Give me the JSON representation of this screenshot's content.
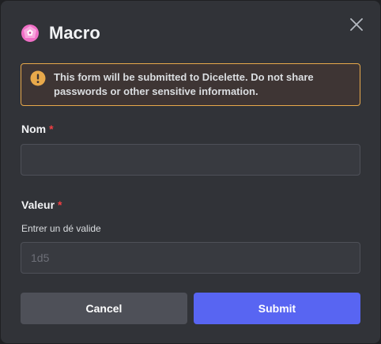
{
  "modal": {
    "title": "Macro",
    "app_icon": "pink-dice-icon",
    "close_icon": "close-icon"
  },
  "warning": {
    "icon": "exclamation-circle-icon",
    "line1": "This form will be submitted to Dicelette. Do not share",
    "line2": "passwords or other sensitive information.",
    "color": "#e8a94b"
  },
  "fields": {
    "nom": {
      "label": "Nom",
      "required_mark": "*",
      "value": "",
      "placeholder": ""
    },
    "valeur": {
      "label": "Valeur",
      "required_mark": "*",
      "description": "Entrer un dé valide",
      "value": "",
      "placeholder": "1d5"
    }
  },
  "buttons": {
    "cancel": "Cancel",
    "submit": "Submit"
  },
  "colors": {
    "background": "#313338",
    "submit": "#5865f2",
    "cancel": "#4e5058",
    "required": "#f23f43"
  }
}
